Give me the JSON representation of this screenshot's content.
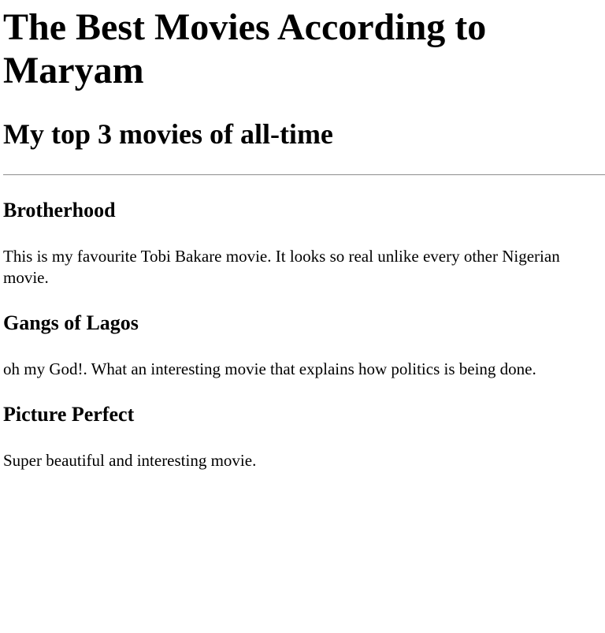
{
  "page": {
    "title": "The Best Movies According to Maryam",
    "subtitle": "My top 3 movies of all-time"
  },
  "movies": [
    {
      "title": "Brotherhood",
      "description": "This is my favourite Tobi Bakare movie. It looks so real unlike every other Nigerian movie."
    },
    {
      "title": "Gangs of Lagos",
      "description": "oh my God!. What an interesting movie that explains how politics is being done."
    },
    {
      "title": "Picture Perfect",
      "description": "Super beautiful and interesting movie."
    }
  ]
}
